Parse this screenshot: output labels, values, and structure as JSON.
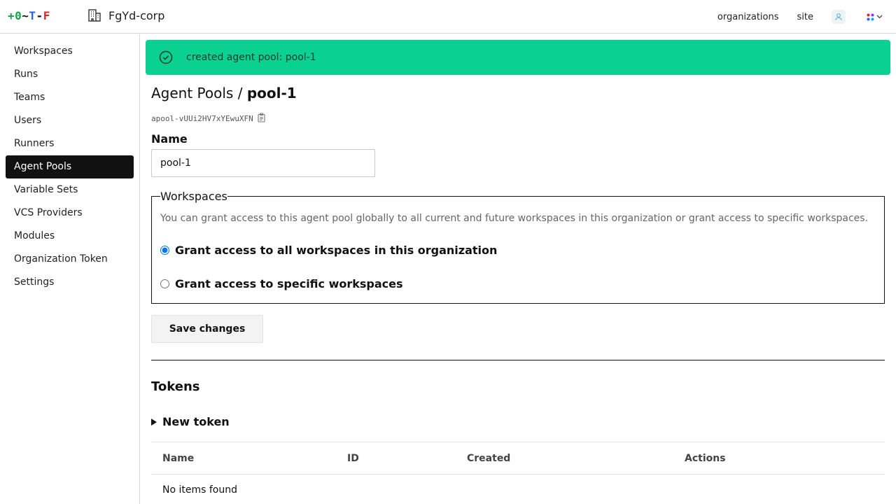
{
  "header": {
    "logo_parts": [
      "+0",
      "~",
      "T",
      "-",
      "F"
    ],
    "org_name": "FgYd-corp",
    "nav": {
      "organizations": "organizations",
      "site": "site"
    }
  },
  "sidebar": {
    "items": [
      {
        "label": "Workspaces",
        "active": false
      },
      {
        "label": "Runs",
        "active": false
      },
      {
        "label": "Teams",
        "active": false
      },
      {
        "label": "Users",
        "active": false
      },
      {
        "label": "Runners",
        "active": false
      },
      {
        "label": "Agent Pools",
        "active": true
      },
      {
        "label": "Variable Sets",
        "active": false
      },
      {
        "label": "VCS Providers",
        "active": false
      },
      {
        "label": "Modules",
        "active": false
      },
      {
        "label": "Organization Token",
        "active": false
      },
      {
        "label": "Settings",
        "active": false
      }
    ]
  },
  "flash": {
    "message": "created agent pool: pool-1",
    "color": "#0ad190"
  },
  "breadcrumb": {
    "parent": "Agent Pools",
    "separator": " / ",
    "current": "pool-1"
  },
  "pool": {
    "id": "apool-vUUi2HV7xYEwuXFN"
  },
  "form": {
    "name_label": "Name",
    "name_value": "pool-1",
    "workspaces_legend": "Workspaces",
    "workspaces_description": "You can grant access to this agent pool globally to all current and future workspaces in this organization or grant access to specific workspaces.",
    "radio_all_label": "Grant access to all workspaces in this organization",
    "radio_specific_label": "Grant access to specific workspaces",
    "selected": "all",
    "save_label": "Save changes"
  },
  "tokens": {
    "title": "Tokens",
    "new_token_label": "New token",
    "columns": {
      "name": "Name",
      "id": "ID",
      "created": "Created",
      "actions": "Actions"
    },
    "empty_text": "No items found"
  }
}
